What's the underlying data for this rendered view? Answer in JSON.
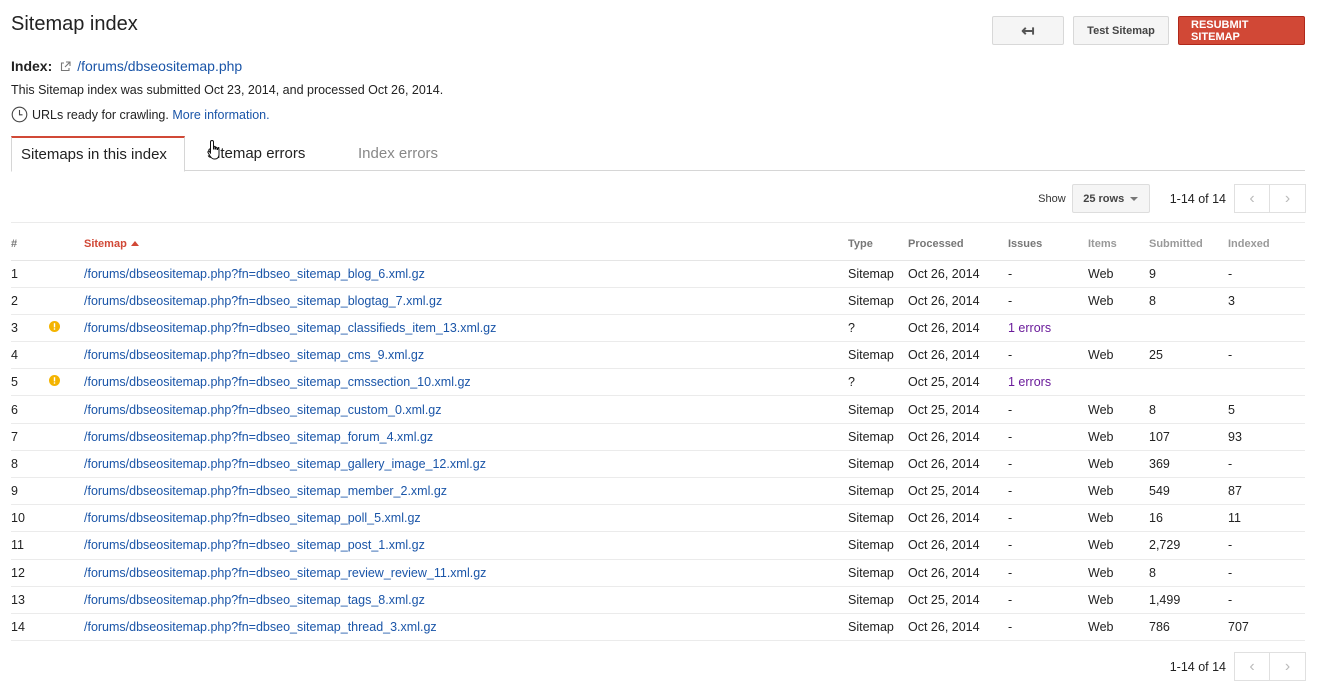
{
  "page": {
    "title": "Sitemap index",
    "back_arrow": "↤",
    "test_button": "Test Sitemap",
    "resubmit_button": "RESUBMIT SITEMAP"
  },
  "index": {
    "label": "Index:",
    "path": "/forums/dbseositemap.php",
    "submitted_text": "This Sitemap index was submitted Oct 23, 2014, and processed Oct 26, 2014.",
    "status_text": "URLs ready for crawling.",
    "more_info": "More information."
  },
  "tabs": [
    {
      "label": "Sitemaps in this index",
      "active": true
    },
    {
      "label": "Sitemap errors",
      "active": false
    },
    {
      "label": "Index errors",
      "active": false
    }
  ],
  "pager": {
    "show_label": "Show",
    "rows_value": "25 rows",
    "range": "1-14 of 14"
  },
  "table": {
    "headers": [
      "#",
      "Sitemap",
      "Type",
      "Processed",
      "Issues",
      "Items",
      "Submitted",
      "Indexed"
    ],
    "rows": [
      {
        "num": "1",
        "warn": false,
        "sitemap": "/forums/dbseositemap.php?fn=dbseo_sitemap_blog_6.xml.gz",
        "type": "Sitemap",
        "processed": "Oct 26, 2014",
        "issues": "-",
        "items": "Web",
        "submitted": "9",
        "indexed": "-"
      },
      {
        "num": "2",
        "warn": false,
        "sitemap": "/forums/dbseositemap.php?fn=dbseo_sitemap_blogtag_7.xml.gz",
        "type": "Sitemap",
        "processed": "Oct 26, 2014",
        "issues": "-",
        "items": "Web",
        "submitted": "8",
        "indexed": "3"
      },
      {
        "num": "3",
        "warn": true,
        "sitemap": "/forums/dbseositemap.php?fn=dbseo_sitemap_classifieds_item_13.xml.gz",
        "type": "?",
        "processed": "Oct 26, 2014",
        "issues": "1 errors",
        "items": "",
        "submitted": "",
        "indexed": ""
      },
      {
        "num": "4",
        "warn": false,
        "sitemap": "/forums/dbseositemap.php?fn=dbseo_sitemap_cms_9.xml.gz",
        "type": "Sitemap",
        "processed": "Oct 26, 2014",
        "issues": "-",
        "items": "Web",
        "submitted": "25",
        "indexed": "-"
      },
      {
        "num": "5",
        "warn": true,
        "sitemap": "/forums/dbseositemap.php?fn=dbseo_sitemap_cmssection_10.xml.gz",
        "type": "?",
        "processed": "Oct 25, 2014",
        "issues": "1 errors",
        "items": "",
        "submitted": "",
        "indexed": ""
      },
      {
        "num": "6",
        "warn": false,
        "sitemap": "/forums/dbseositemap.php?fn=dbseo_sitemap_custom_0.xml.gz",
        "type": "Sitemap",
        "processed": "Oct 25, 2014",
        "issues": "-",
        "items": "Web",
        "submitted": "8",
        "indexed": "5"
      },
      {
        "num": "7",
        "warn": false,
        "sitemap": "/forums/dbseositemap.php?fn=dbseo_sitemap_forum_4.xml.gz",
        "type": "Sitemap",
        "processed": "Oct 26, 2014",
        "issues": "-",
        "items": "Web",
        "submitted": "107",
        "indexed": "93"
      },
      {
        "num": "8",
        "warn": false,
        "sitemap": "/forums/dbseositemap.php?fn=dbseo_sitemap_gallery_image_12.xml.gz",
        "type": "Sitemap",
        "processed": "Oct 26, 2014",
        "issues": "-",
        "items": "Web",
        "submitted": "369",
        "indexed": "-"
      },
      {
        "num": "9",
        "warn": false,
        "sitemap": "/forums/dbseositemap.php?fn=dbseo_sitemap_member_2.xml.gz",
        "type": "Sitemap",
        "processed": "Oct 25, 2014",
        "issues": "-",
        "items": "Web",
        "submitted": "549",
        "indexed": "87"
      },
      {
        "num": "10",
        "warn": false,
        "sitemap": "/forums/dbseositemap.php?fn=dbseo_sitemap_poll_5.xml.gz",
        "type": "Sitemap",
        "processed": "Oct 26, 2014",
        "issues": "-",
        "items": "Web",
        "submitted": "16",
        "indexed": "11"
      },
      {
        "num": "11",
        "warn": false,
        "sitemap": "/forums/dbseositemap.php?fn=dbseo_sitemap_post_1.xml.gz",
        "type": "Sitemap",
        "processed": "Oct 26, 2014",
        "issues": "-",
        "items": "Web",
        "submitted": "2,729",
        "indexed": "-"
      },
      {
        "num": "12",
        "warn": false,
        "sitemap": "/forums/dbseositemap.php?fn=dbseo_sitemap_review_review_11.xml.gz",
        "type": "Sitemap",
        "processed": "Oct 26, 2014",
        "issues": "-",
        "items": "Web",
        "submitted": "8",
        "indexed": "-"
      },
      {
        "num": "13",
        "warn": false,
        "sitemap": "/forums/dbseositemap.php?fn=dbseo_sitemap_tags_8.xml.gz",
        "type": "Sitemap",
        "processed": "Oct 25, 2014",
        "issues": "-",
        "items": "Web",
        "submitted": "1,499",
        "indexed": "-"
      },
      {
        "num": "14",
        "warn": false,
        "sitemap": "/forums/dbseositemap.php?fn=dbseo_sitemap_thread_3.xml.gz",
        "type": "Sitemap",
        "processed": "Oct 26, 2014",
        "issues": "-",
        "items": "Web",
        "submitted": "786",
        "indexed": "707"
      }
    ]
  },
  "colors": {
    "accent_red": "#d14836",
    "link_blue": "#1a55a8",
    "warning_yellow": "#f4b400",
    "error_purple": "#6a1b9a"
  }
}
